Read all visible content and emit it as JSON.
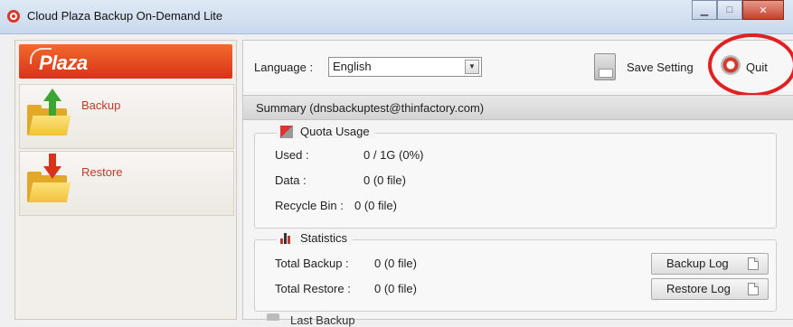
{
  "window": {
    "title": "Cloud Plaza Backup On-Demand Lite",
    "controls": {
      "minimize": "▁",
      "maximize": "□",
      "close": "✕"
    }
  },
  "sidebar": {
    "logo": "Plaza",
    "items": [
      {
        "label": "Backup",
        "icon": "folder-upload-icon"
      },
      {
        "label": "Restore",
        "icon": "folder-download-icon"
      }
    ]
  },
  "toolbar": {
    "language_label": "Language :",
    "language_value": "English",
    "save_label": "Save Setting",
    "quit_label": "Quit"
  },
  "summary": {
    "header": "Summary (dnsbackuptest@thinfactory.com)",
    "quota": {
      "title": "Quota Usage",
      "rows": [
        {
          "label": "Used :",
          "value": "0 / 1G (0%)"
        },
        {
          "label": "Data :",
          "value": "0  (0 file)"
        },
        {
          "label": "Recycle Bin :",
          "value": "0  (0 file)"
        }
      ]
    },
    "statistics": {
      "title": "Statistics",
      "rows": [
        {
          "label": "Total Backup :",
          "value": "0  (0 file)"
        },
        {
          "label": "Total Restore :",
          "value": "0  (0 file)"
        }
      ],
      "backup_log_label": "Backup Log",
      "restore_log_label": "Restore Log"
    },
    "next_section_partial": "Last Backup"
  },
  "colors": {
    "accent_red": "#d9321b",
    "highlight_circle": "#e32020",
    "backup_arrow": "#3aa531"
  }
}
